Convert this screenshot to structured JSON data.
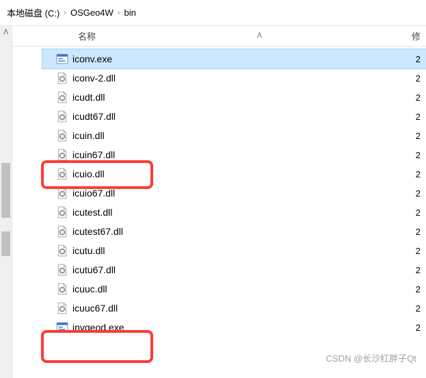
{
  "breadcrumb": {
    "parts": [
      "本地磁盘 (C:)",
      "OSGeo4W",
      "bin"
    ]
  },
  "headers": {
    "name": "名称",
    "mod": "修"
  },
  "files": [
    {
      "name": "iconv.exe",
      "type": "exe",
      "date": "2",
      "selected": true
    },
    {
      "name": "iconv-2.dll",
      "type": "dll",
      "date": "2"
    },
    {
      "name": "icudt.dll",
      "type": "dll",
      "date": "2"
    },
    {
      "name": "icudt67.dll",
      "type": "dll",
      "date": "2"
    },
    {
      "name": "icuin.dll",
      "type": "dll",
      "date": "2"
    },
    {
      "name": "icuin67.dll",
      "type": "dll",
      "date": "2"
    },
    {
      "name": "icuio.dll",
      "type": "dll",
      "date": "2"
    },
    {
      "name": "icuio67.dll",
      "type": "dll",
      "date": "2"
    },
    {
      "name": "icutest.dll",
      "type": "dll",
      "date": "2"
    },
    {
      "name": "icutest67.dll",
      "type": "dll",
      "date": "2"
    },
    {
      "name": "icutu.dll",
      "type": "dll",
      "date": "2"
    },
    {
      "name": "icutu67.dll",
      "type": "dll",
      "date": "2"
    },
    {
      "name": "icuuc.dll",
      "type": "dll",
      "date": "2"
    },
    {
      "name": "icuuc67.dll",
      "type": "dll",
      "date": "2"
    },
    {
      "name": "invgeod.exe",
      "type": "exe",
      "date": "2"
    }
  ],
  "watermark": "CSDN @长沙红胖子Qt"
}
